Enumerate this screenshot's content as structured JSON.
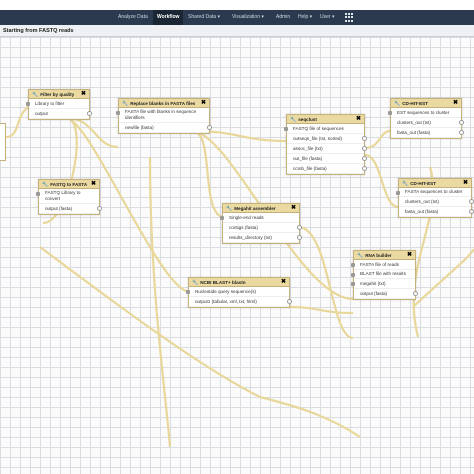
{
  "nav": {
    "items": [
      "Analyze Data",
      "Workflow",
      "Shared Data ▾",
      "Visualization ▾",
      "Admin",
      "Help ▾",
      "User ▾"
    ],
    "active": "Workflow"
  },
  "workflow": {
    "title": "Starting from FASTQ reads"
  },
  "nodes": {
    "filter": {
      "title": "Filter by quality",
      "rows": [
        "Library to filter",
        "output"
      ]
    },
    "replace": {
      "title": "Replace blanks in FASTA files",
      "rows": [
        "FASTA file with blanks in sequence identifiers",
        "newfile (fasta)"
      ]
    },
    "seqclust": {
      "title": "seqclust",
      "rows": [
        "FASTQ file of sequences",
        "outseqs_file (txt, sorted)",
        "assoc_file (txt)",
        "out_file (fasta)",
        "ccmb_file (fasta)"
      ]
    },
    "cdhit1": {
      "title": "CD-HIT-EST",
      "rows": [
        "EST sequences to cluster",
        "clusters_out (txt)",
        "fasta_out (fasta)"
      ]
    },
    "fastq2fasta": {
      "title": "FASTQ to FASTA",
      "rows": [
        "FASTQ Library to convert",
        "output (fasta)"
      ]
    },
    "cdhit2": {
      "title": "CD-HIT-EST",
      "rows": [
        "FASTA sequences to cluster",
        "clusters_out (txt)",
        "fasta_out (fasta)"
      ]
    },
    "megahit": {
      "title": "Megahit assembler",
      "rows": [
        "Single-end reads",
        "contigs (fasta)",
        "results_directory (txt)"
      ]
    },
    "blastn": {
      "title": "NCBI BLAST+ blastn",
      "rows": [
        "Nucleotide query sequence(s)",
        "output1 (tabular, xml, txt, html)"
      ]
    },
    "rna": {
      "title": "RNA builder",
      "rows": [
        "FASTA file of reads",
        "BLAST file with results",
        "megahit (txt)",
        "output (fasta)"
      ]
    }
  }
}
